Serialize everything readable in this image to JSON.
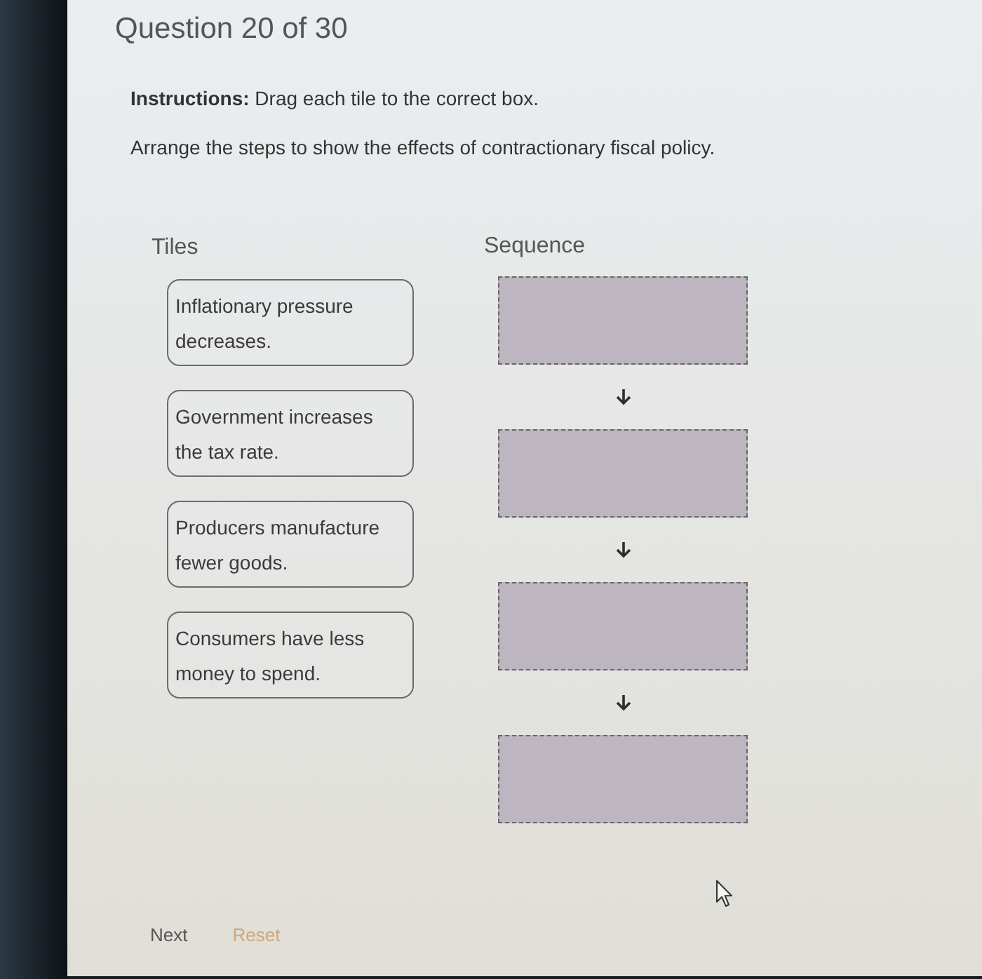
{
  "question": {
    "counter": "Question 20 of 30"
  },
  "instructions": "**Instructions:** Drag each tile to the correct box.",
  "prompt": "Arrange the steps to show the effects of contractionary fiscal policy.",
  "tiles": {
    "heading": "Tiles",
    "items": [
      {
        "text": "Inflationary pressure decreases."
      },
      {
        "text": "Government increases the tax rate."
      },
      {
        "text": "Producers manufacture fewer goods."
      },
      {
        "text": "Consumers have less money to spend."
      }
    ]
  },
  "sequence": {
    "heading": "Sequence",
    "slots": [
      {
        "filled": false
      },
      {
        "filled": false
      },
      {
        "filled": false
      },
      {
        "filled": false
      }
    ]
  },
  "buttons": [
    {
      "label": "Next",
      "disabled": false
    },
    {
      "label": "Reset",
      "disabled": true
    }
  ]
}
